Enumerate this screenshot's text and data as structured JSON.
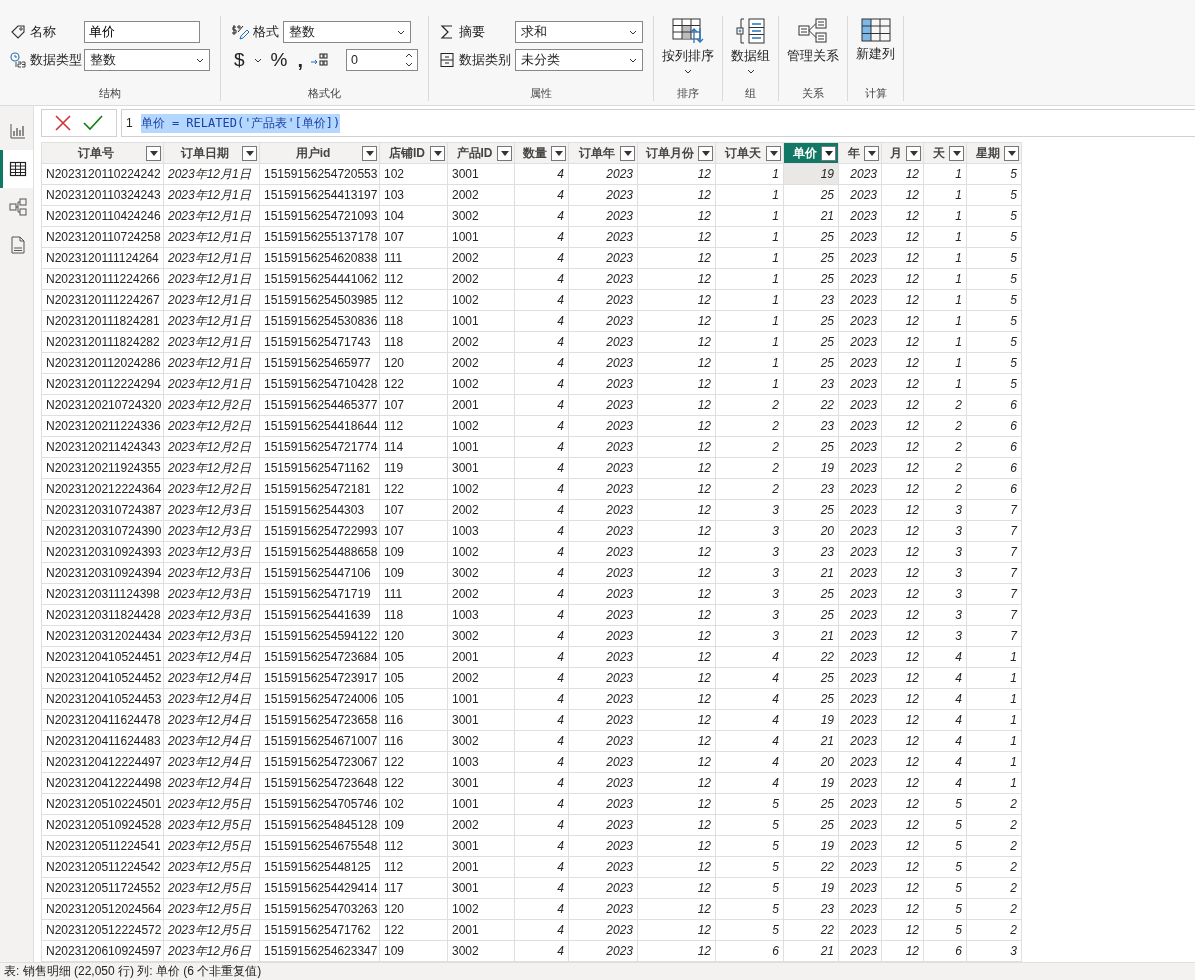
{
  "ribbon": {
    "structure": {
      "label": "结构",
      "name_label": "名称",
      "name_value": "单价",
      "type_label": "数据类型",
      "type_value": "整数"
    },
    "formatting": {
      "label": "格式化",
      "format_label": "格式",
      "format_value": "整数",
      "currency": "$",
      "percent": "%",
      "comma": ",",
      "decimals": "0"
    },
    "properties": {
      "label": "属性",
      "summary_label": "摘要",
      "summary_value": "求和",
      "category_label": "数据类别",
      "category_value": "未分类"
    },
    "commands": [
      {
        "kind": "sort",
        "label": "按列排序",
        "dropdown": true,
        "group": "排序"
      },
      {
        "kind": "group",
        "label": "数据组",
        "dropdown": true,
        "group": "组"
      },
      {
        "kind": "relations",
        "label": "管理关系",
        "dropdown": false,
        "group": "关系"
      },
      {
        "kind": "newcolumn",
        "label": "新建列",
        "dropdown": false,
        "group": "计算"
      }
    ]
  },
  "sidebar": {
    "items": [
      {
        "kind": "report",
        "selected": false
      },
      {
        "kind": "table",
        "selected": true
      },
      {
        "kind": "model",
        "selected": false
      },
      {
        "kind": "dax",
        "selected": false
      }
    ]
  },
  "formula_bar": {
    "line_number": "1",
    "text": "单价 = RELATED('产品表'[单价])"
  },
  "table": {
    "columns": [
      {
        "label": "订单号",
        "kind": "text",
        "selected": false
      },
      {
        "label": "订单日期",
        "kind": "date",
        "selected": false
      },
      {
        "label": "用户id",
        "kind": "text",
        "selected": false
      },
      {
        "label": "店铺ID",
        "kind": "text",
        "selected": false
      },
      {
        "label": "产品ID",
        "kind": "text",
        "selected": false
      },
      {
        "label": "数量",
        "kind": "number",
        "selected": false
      },
      {
        "label": "订单年",
        "kind": "number",
        "selected": false
      },
      {
        "label": "订单月份",
        "kind": "number",
        "selected": false
      },
      {
        "label": "订单天",
        "kind": "number",
        "selected": false
      },
      {
        "label": "单价",
        "kind": "number",
        "selected": true
      },
      {
        "label": "年",
        "kind": "number",
        "selected": false
      },
      {
        "label": "月",
        "kind": "number",
        "selected": false
      },
      {
        "label": "天",
        "kind": "number",
        "selected": false
      },
      {
        "label": "星期",
        "kind": "number",
        "selected": false
      }
    ],
    "rows": [
      [
        "N2023120110224242",
        "2023年12月1日",
        "15159156254720553",
        "102",
        "3001",
        "4",
        "2023",
        "12",
        "1",
        {
          "text": "19",
          "selected": true
        },
        "2023",
        "12",
        "1",
        "5"
      ],
      [
        "N2023120110324243",
        "2023年12月1日",
        "15159156254413197",
        "103",
        "2002",
        "4",
        "2023",
        "12",
        "1",
        "25",
        "2023",
        "12",
        "1",
        "5"
      ],
      [
        "N2023120110424246",
        "2023年12月1日",
        "15159156254721093",
        "104",
        "3002",
        "4",
        "2023",
        "12",
        "1",
        "21",
        "2023",
        "12",
        "1",
        "5"
      ],
      [
        "N2023120110724258",
        "2023年12月1日",
        "15159156255137178",
        "107",
        "1001",
        "4",
        "2023",
        "12",
        "1",
        "25",
        "2023",
        "12",
        "1",
        "5"
      ],
      [
        "N2023120111124264",
        "2023年12月1日",
        "15159156254620838",
        "111",
        "2002",
        "4",
        "2023",
        "12",
        "1",
        "25",
        "2023",
        "12",
        "1",
        "5"
      ],
      [
        "N2023120111224266",
        "2023年12月1日",
        "15159156254441062",
        "112",
        "2002",
        "4",
        "2023",
        "12",
        "1",
        "25",
        "2023",
        "12",
        "1",
        "5"
      ],
      [
        "N2023120111224267",
        "2023年12月1日",
        "15159156254503985",
        "112",
        "1002",
        "4",
        "2023",
        "12",
        "1",
        "23",
        "2023",
        "12",
        "1",
        "5"
      ],
      [
        "N2023120111824281",
        "2023年12月1日",
        "15159156254530836",
        "118",
        "1001",
        "4",
        "2023",
        "12",
        "1",
        "25",
        "2023",
        "12",
        "1",
        "5"
      ],
      [
        "N2023120111824282",
        "2023年12月1日",
        "1515915625471743",
        "118",
        "2002",
        "4",
        "2023",
        "12",
        "1",
        "25",
        "2023",
        "12",
        "1",
        "5"
      ],
      [
        "N2023120112024286",
        "2023年12月1日",
        "1515915625465977",
        "120",
        "2002",
        "4",
        "2023",
        "12",
        "1",
        "25",
        "2023",
        "12",
        "1",
        "5"
      ],
      [
        "N2023120112224294",
        "2023年12月1日",
        "15159156254710428",
        "122",
        "1002",
        "4",
        "2023",
        "12",
        "1",
        "23",
        "2023",
        "12",
        "1",
        "5"
      ],
      [
        "N2023120210724320",
        "2023年12月2日",
        "15159156254465377",
        "107",
        "2001",
        "4",
        "2023",
        "12",
        "2",
        "22",
        "2023",
        "12",
        "2",
        "6"
      ],
      [
        "N2023120211224336",
        "2023年12月2日",
        "15159156254418644",
        "112",
        "1002",
        "4",
        "2023",
        "12",
        "2",
        "23",
        "2023",
        "12",
        "2",
        "6"
      ],
      [
        "N2023120211424343",
        "2023年12月2日",
        "15159156254721774",
        "114",
        "1001",
        "4",
        "2023",
        "12",
        "2",
        "25",
        "2023",
        "12",
        "2",
        "6"
      ],
      [
        "N2023120211924355",
        "2023年12月2日",
        "1515915625471162",
        "119",
        "3001",
        "4",
        "2023",
        "12",
        "2",
        "19",
        "2023",
        "12",
        "2",
        "6"
      ],
      [
        "N2023120212224364",
        "2023年12月2日",
        "1515915625472181",
        "122",
        "1002",
        "4",
        "2023",
        "12",
        "2",
        "23",
        "2023",
        "12",
        "2",
        "6"
      ],
      [
        "N2023120310724387",
        "2023年12月3日",
        "151591562544303",
        "107",
        "2002",
        "4",
        "2023",
        "12",
        "3",
        "25",
        "2023",
        "12",
        "3",
        "7"
      ],
      [
        "N2023120310724390",
        "2023年12月3日",
        "15159156254722993",
        "107",
        "1003",
        "4",
        "2023",
        "12",
        "3",
        "20",
        "2023",
        "12",
        "3",
        "7"
      ],
      [
        "N2023120310924393",
        "2023年12月3日",
        "15159156254488658",
        "109",
        "1002",
        "4",
        "2023",
        "12",
        "3",
        "23",
        "2023",
        "12",
        "3",
        "7"
      ],
      [
        "N2023120310924394",
        "2023年12月3日",
        "1515915625447106",
        "109",
        "3002",
        "4",
        "2023",
        "12",
        "3",
        "21",
        "2023",
        "12",
        "3",
        "7"
      ],
      [
        "N2023120311124398",
        "2023年12月3日",
        "1515915625471719",
        "111",
        "2002",
        "4",
        "2023",
        "12",
        "3",
        "25",
        "2023",
        "12",
        "3",
        "7"
      ],
      [
        "N2023120311824428",
        "2023年12月3日",
        "1515915625441639",
        "118",
        "1003",
        "4",
        "2023",
        "12",
        "3",
        "25",
        "2023",
        "12",
        "3",
        "7"
      ],
      [
        "N2023120312024434",
        "2023年12月3日",
        "15159156254594122",
        "120",
        "3002",
        "4",
        "2023",
        "12",
        "3",
        "21",
        "2023",
        "12",
        "3",
        "7"
      ],
      [
        "N2023120410524451",
        "2023年12月4日",
        "15159156254723684",
        "105",
        "2001",
        "4",
        "2023",
        "12",
        "4",
        "22",
        "2023",
        "12",
        "4",
        "1"
      ],
      [
        "N2023120410524452",
        "2023年12月4日",
        "15159156254723917",
        "105",
        "2002",
        "4",
        "2023",
        "12",
        "4",
        "25",
        "2023",
        "12",
        "4",
        "1"
      ],
      [
        "N2023120410524453",
        "2023年12月4日",
        "15159156254724006",
        "105",
        "1001",
        "4",
        "2023",
        "12",
        "4",
        "25",
        "2023",
        "12",
        "4",
        "1"
      ],
      [
        "N2023120411624478",
        "2023年12月4日",
        "15159156254723658",
        "116",
        "3001",
        "4",
        "2023",
        "12",
        "4",
        "19",
        "2023",
        "12",
        "4",
        "1"
      ],
      [
        "N2023120411624483",
        "2023年12月4日",
        "15159156254671007",
        "116",
        "3002",
        "4",
        "2023",
        "12",
        "4",
        "21",
        "2023",
        "12",
        "4",
        "1"
      ],
      [
        "N2023120412224497",
        "2023年12月4日",
        "15159156254723067",
        "122",
        "1003",
        "4",
        "2023",
        "12",
        "4",
        "20",
        "2023",
        "12",
        "4",
        "1"
      ],
      [
        "N2023120412224498",
        "2023年12月4日",
        "15159156254723648",
        "122",
        "3001",
        "4",
        "2023",
        "12",
        "4",
        "19",
        "2023",
        "12",
        "4",
        "1"
      ],
      [
        "N2023120510224501",
        "2023年12月5日",
        "15159156254705746",
        "102",
        "1001",
        "4",
        "2023",
        "12",
        "5",
        "25",
        "2023",
        "12",
        "5",
        "2"
      ],
      [
        "N2023120510924528",
        "2023年12月5日",
        "15159156254845128",
        "109",
        "2002",
        "4",
        "2023",
        "12",
        "5",
        "25",
        "2023",
        "12",
        "5",
        "2"
      ],
      [
        "N2023120511224541",
        "2023年12月5日",
        "15159156254675548",
        "112",
        "3001",
        "4",
        "2023",
        "12",
        "5",
        "19",
        "2023",
        "12",
        "5",
        "2"
      ],
      [
        "N2023120511224542",
        "2023年12月5日",
        "1515915625448125",
        "112",
        "2001",
        "4",
        "2023",
        "12",
        "5",
        "22",
        "2023",
        "12",
        "5",
        "2"
      ],
      [
        "N2023120511724552",
        "2023年12月5日",
        "15159156254429414",
        "117",
        "3001",
        "4",
        "2023",
        "12",
        "5",
        "19",
        "2023",
        "12",
        "5",
        "2"
      ],
      [
        "N2023120512024564",
        "2023年12月5日",
        "15159156254703263",
        "120",
        "1002",
        "4",
        "2023",
        "12",
        "5",
        "23",
        "2023",
        "12",
        "5",
        "2"
      ],
      [
        "N2023120512224572",
        "2023年12月5日",
        "1515915625471762",
        "122",
        "2001",
        "4",
        "2023",
        "12",
        "5",
        "22",
        "2023",
        "12",
        "5",
        "2"
      ],
      [
        "N2023120610924597",
        "2023年12月6日",
        "15159156254623347",
        "109",
        "3002",
        "4",
        "2023",
        "12",
        "6",
        "21",
        "2023",
        "12",
        "6",
        "3"
      ]
    ]
  },
  "status_bar": {
    "text": "表: 销售明细 (22,050 行) 列: 单价 (6 个非重复值)"
  }
}
